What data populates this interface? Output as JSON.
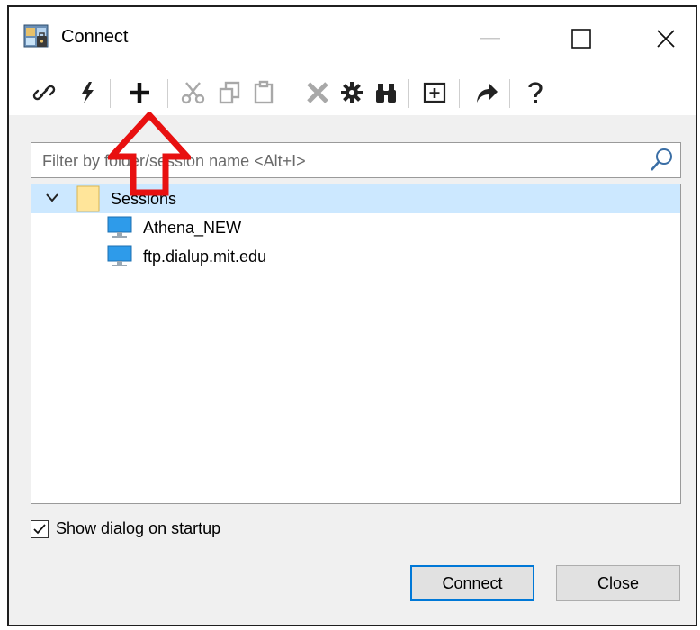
{
  "window": {
    "title": "Connect",
    "controls": [
      "minimize",
      "maximize",
      "close"
    ]
  },
  "toolbar": {
    "icons": [
      "link-icon",
      "lightning-icon",
      "add-icon",
      "cut-icon",
      "copy-icon",
      "paste-icon",
      "delete-icon",
      "properties-gear-icon",
      "find-binoculars-icon",
      "new-folder-icon",
      "share-arrow-icon",
      "help-icon"
    ]
  },
  "filter": {
    "placeholder": "Filter by folder/session name <Alt+I>"
  },
  "tree": {
    "folder": "Sessions",
    "sessions": [
      "Athena_NEW",
      "ftp.dialup.mit.edu"
    ]
  },
  "options": {
    "show_dialog_label": "Show dialog on startup",
    "show_dialog_checked": true
  },
  "buttons": {
    "connect": "Connect",
    "close": "Close"
  },
  "colors": {
    "highlight_arrow": "#e81010",
    "selection": "#cce8ff",
    "default_button_border": "#0078d7"
  }
}
